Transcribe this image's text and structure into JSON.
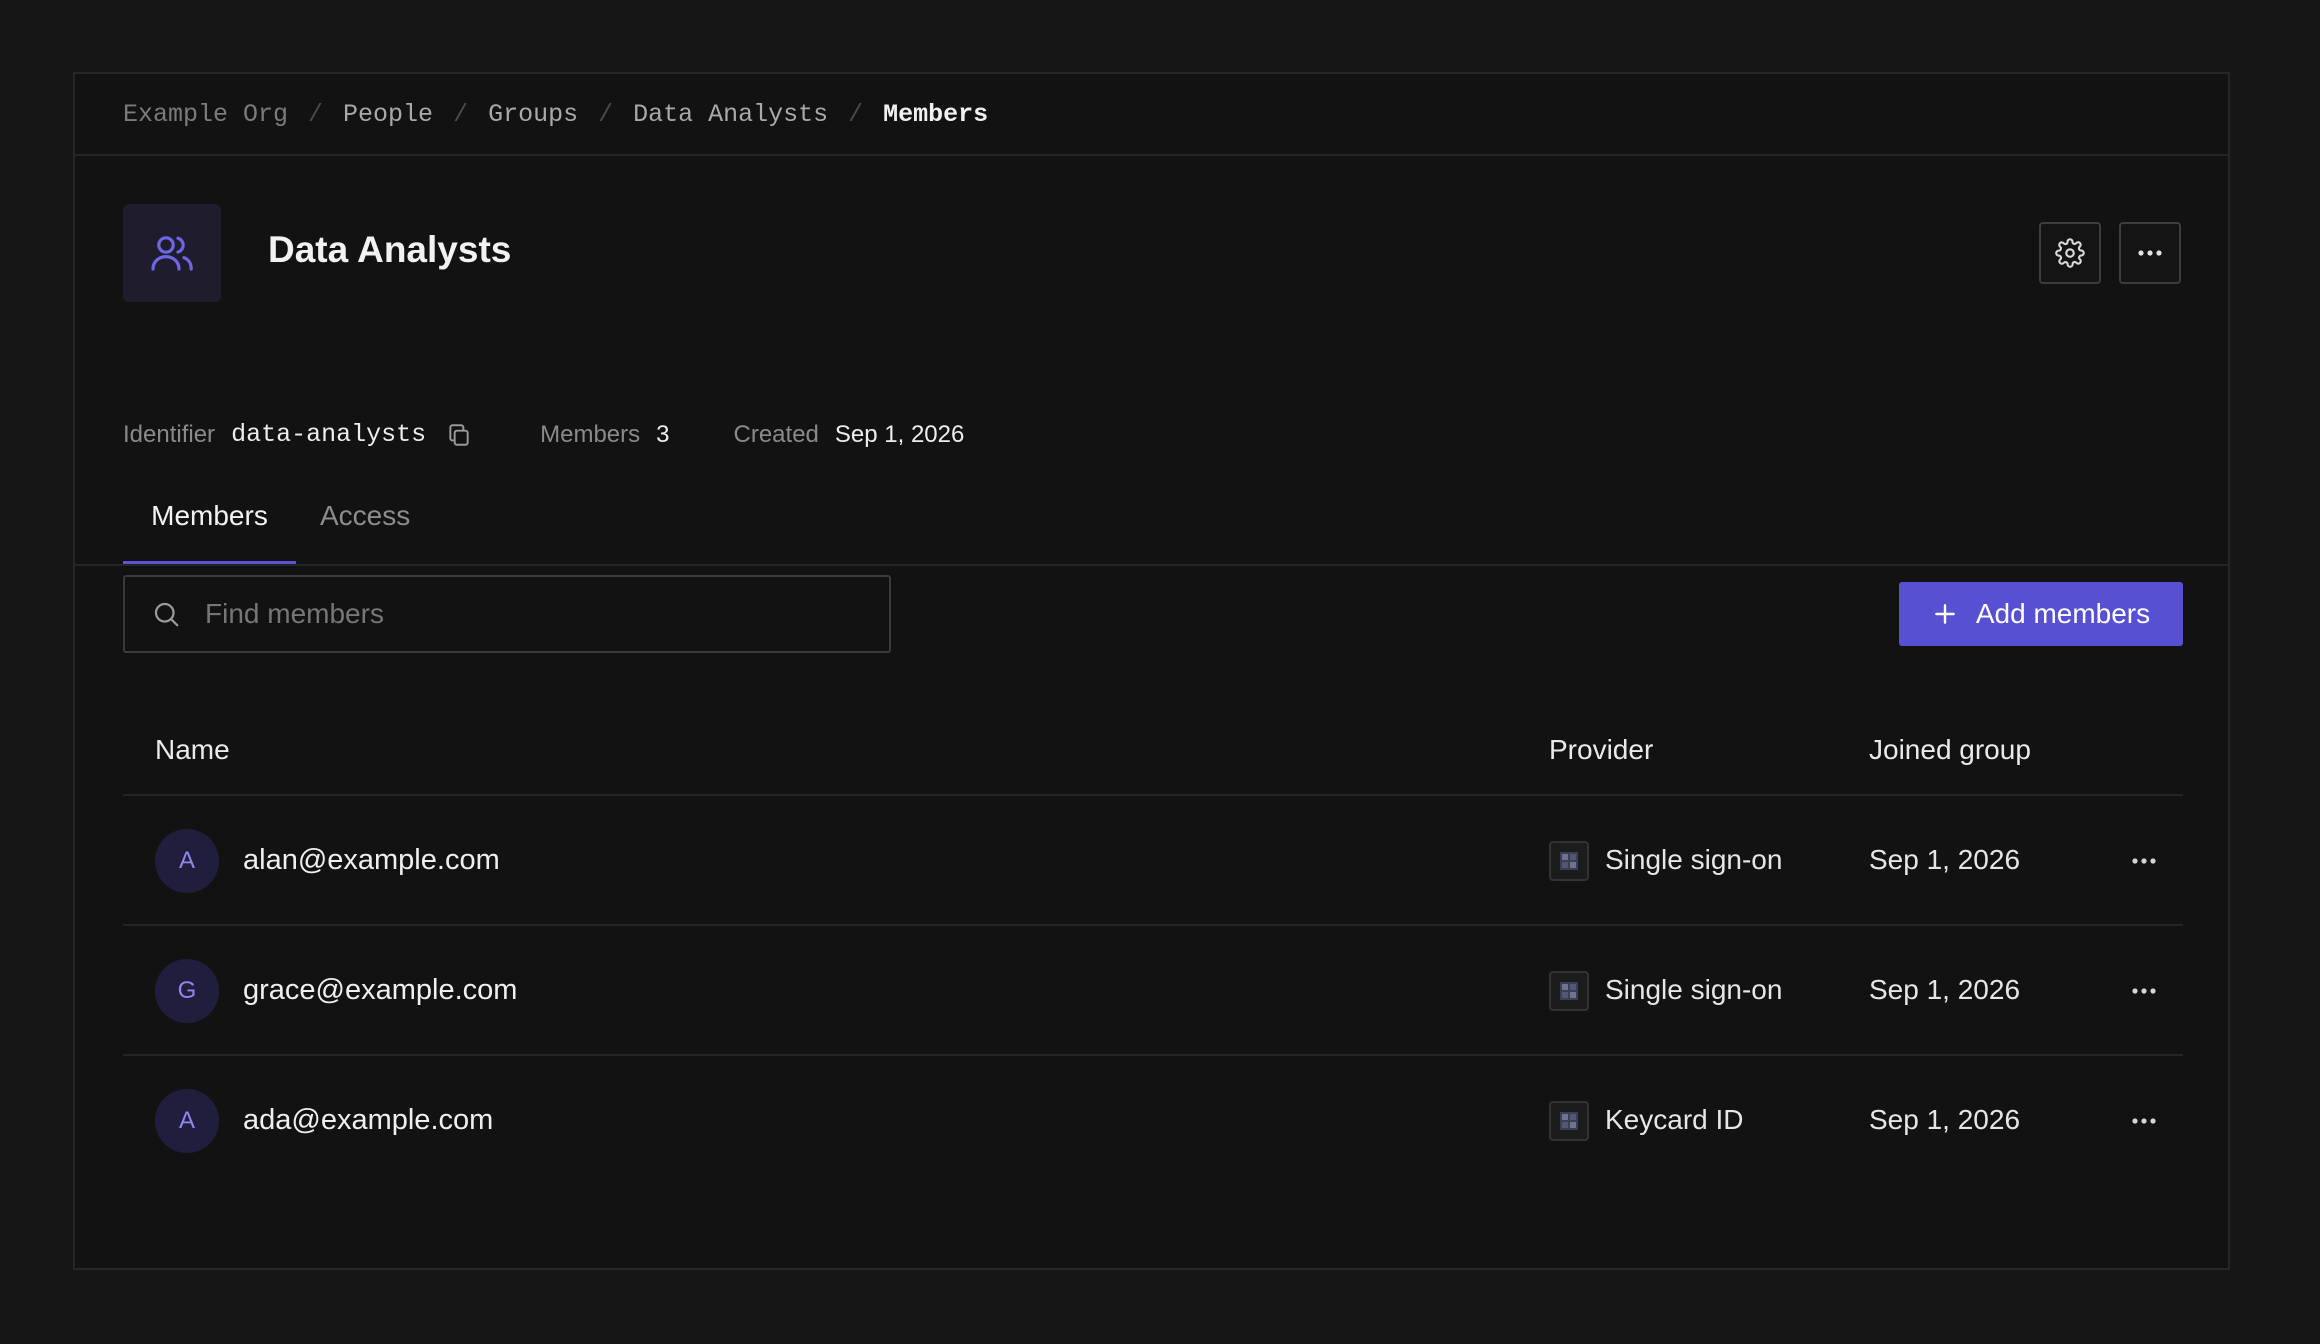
{
  "breadcrumb": {
    "items": [
      "Example Org",
      "People",
      "Groups",
      "Data Analysts",
      "Members"
    ],
    "separator": "/"
  },
  "group": {
    "title": "Data Analysts",
    "icon": "users-icon",
    "identifier_label": "Identifier",
    "identifier_value": "data-analysts",
    "members_label": "Members",
    "members_value": "3",
    "created_label": "Created",
    "created_value": "Sep 1, 2026"
  },
  "header_actions": {
    "settings_icon": "gear-icon",
    "more_icon": "more-horizontal-icon"
  },
  "tabs": [
    {
      "label": "Members",
      "active": true
    },
    {
      "label": "Access",
      "active": false
    }
  ],
  "search": {
    "placeholder": "Find members",
    "value": ""
  },
  "add_button": {
    "label": "Add members"
  },
  "table": {
    "columns": [
      "Name",
      "Provider",
      "Joined group"
    ],
    "rows": [
      {
        "initial": "A",
        "email": "alan@example.com",
        "provider": "Single sign-on",
        "joined": "Sep 1, 2026"
      },
      {
        "initial": "G",
        "email": "grace@example.com",
        "provider": "Single sign-on",
        "joined": "Sep 1, 2026"
      },
      {
        "initial": "A",
        "email": "ada@example.com",
        "provider": "Keycard ID",
        "joined": "Sep 1, 2026"
      }
    ]
  },
  "colors": {
    "accent": "#5750d3",
    "background": "#161616",
    "panel": "#121212"
  }
}
